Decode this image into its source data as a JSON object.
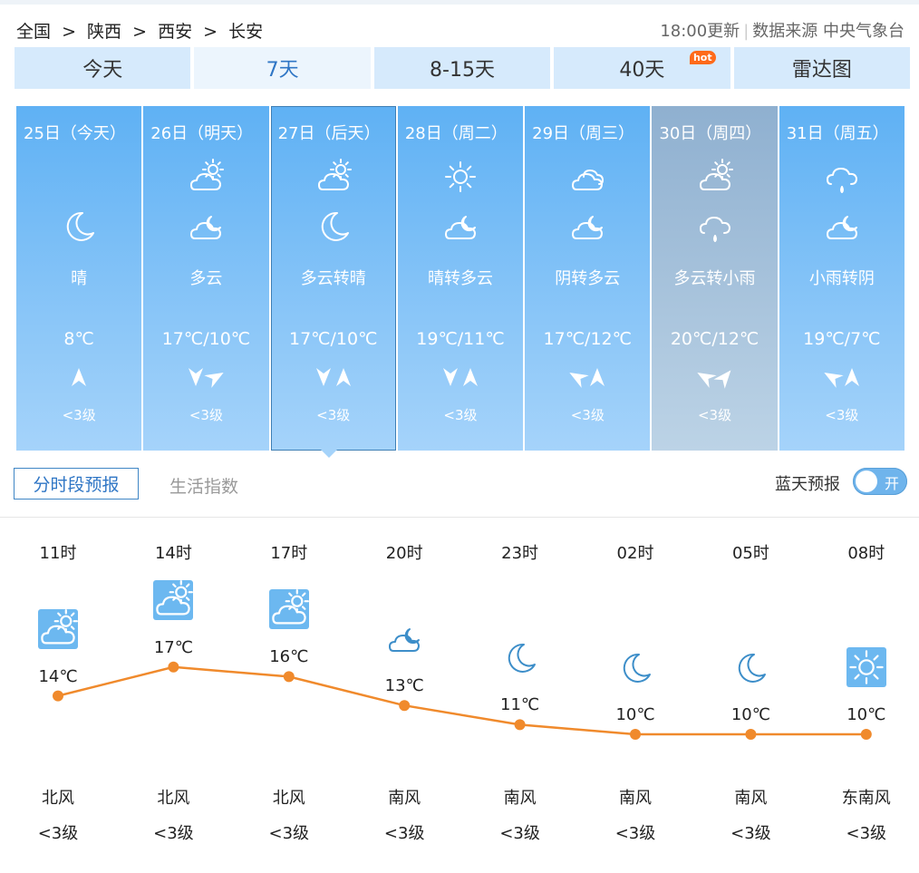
{
  "breadcrumb": [
    "全国",
    "陕西",
    "西安",
    "长安"
  ],
  "breadcrumb_sep": ">",
  "update_time": "18:00更新",
  "source": "数据来源 中央气象台",
  "tabs": [
    {
      "label": "今天",
      "active": false
    },
    {
      "label": "7天",
      "active": true
    },
    {
      "label": "8-15天",
      "active": false
    },
    {
      "label": "40天",
      "active": false,
      "badge": "hot"
    },
    {
      "label": "雷达图",
      "active": false
    }
  ],
  "days": [
    {
      "date": "25日（今天）",
      "icon1": "",
      "icon2": "moon",
      "desc": "晴",
      "temp": "8℃",
      "winds": [
        "arrow-up"
      ],
      "level": "<3级"
    },
    {
      "date": "26日（明天）",
      "icon1": "partly-cloudy-sun",
      "icon2": "cloudy-night",
      "desc": "多云",
      "temp": "17℃/10℃",
      "winds": [
        "arrow-down",
        "arrow-right"
      ],
      "level": "<3级"
    },
    {
      "date": "27日（后天）",
      "icon1": "partly-cloudy-sun",
      "icon2": "moon",
      "desc": "多云转晴",
      "temp": "17℃/10℃",
      "winds": [
        "arrow-down",
        "arrow-up"
      ],
      "level": "<3级",
      "selected": true
    },
    {
      "date": "28日（周二）",
      "icon1": "sun",
      "icon2": "cloudy-night",
      "desc": "晴转多云",
      "temp": "19℃/11℃",
      "winds": [
        "arrow-down",
        "arrow-up"
      ],
      "level": "<3级"
    },
    {
      "date": "29日（周三）",
      "icon1": "overcast",
      "icon2": "cloudy-night",
      "desc": "阴转多云",
      "temp": "17℃/12℃",
      "winds": [
        "arrow-left",
        "arrow-up"
      ],
      "level": "<3级"
    },
    {
      "date": "30日（周四）",
      "icon1": "partly-cloudy-sun",
      "icon2": "light-rain",
      "desc": "多云转小雨",
      "temp": "20℃/12℃",
      "winds": [
        "arrow-left",
        "arrow-right-up"
      ],
      "level": "<3级",
      "gray": true
    },
    {
      "date": "31日（周五）",
      "icon1": "light-rain",
      "icon2": "cloudy-night",
      "desc": "小雨转阴",
      "temp": "19℃/7℃",
      "winds": [
        "arrow-left",
        "arrow-up"
      ],
      "level": "<3级"
    }
  ],
  "subtabs": {
    "active": "分时段预报",
    "other": "生活指数"
  },
  "bluesky": {
    "label": "蓝天预报",
    "toggle": "开"
  },
  "hourly": [
    {
      "hour": "11时",
      "icon": "partly-cloudy-sun",
      "tile": true,
      "temp": 14,
      "temp_label": "14℃",
      "wind": "北风",
      "level": "<3级"
    },
    {
      "hour": "14时",
      "icon": "partly-cloudy-sun",
      "tile": true,
      "temp": 17,
      "temp_label": "17℃",
      "wind": "北风",
      "level": "<3级"
    },
    {
      "hour": "17时",
      "icon": "partly-cloudy-sun",
      "tile": true,
      "temp": 16,
      "temp_label": "16℃",
      "wind": "北风",
      "level": "<3级"
    },
    {
      "hour": "20时",
      "icon": "cloudy-night",
      "tile": false,
      "temp": 13,
      "temp_label": "13℃",
      "wind": "南风",
      "level": "<3级"
    },
    {
      "hour": "23时",
      "icon": "moon",
      "tile": false,
      "temp": 11,
      "temp_label": "11℃",
      "wind": "南风",
      "level": "<3级"
    },
    {
      "hour": "02时",
      "icon": "moon",
      "tile": false,
      "temp": 10,
      "temp_label": "10℃",
      "wind": "南风",
      "level": "<3级"
    },
    {
      "hour": "05时",
      "icon": "moon",
      "tile": false,
      "temp": 10,
      "temp_label": "10℃",
      "wind": "南风",
      "level": "<3级"
    },
    {
      "hour": "08时",
      "icon": "sun",
      "tile": true,
      "temp": 10,
      "temp_label": "10℃",
      "wind": "东南风",
      "level": "<3级"
    }
  ],
  "colors": {
    "accent": "#2f76c5",
    "line": "#f08a2c",
    "tile": "#6cb8f0",
    "icon_dark": "#3d8ec9"
  }
}
